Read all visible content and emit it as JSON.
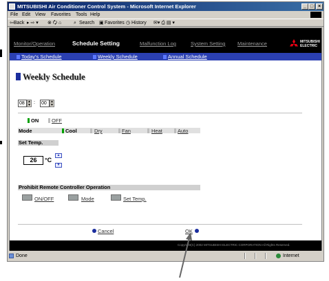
{
  "window": {
    "title": "MITSUBISHI Air Conditioner Control System - Microsoft Internet Explorer",
    "min_symbol": "_",
    "max_symbol": "□",
    "close_symbol": "×"
  },
  "menubar": [
    "File",
    "Edit",
    "View",
    "Favorites",
    "Tools",
    "Help"
  ],
  "toolbar": {
    "back": "⇦Back",
    "forward": "▸ ⇨ ▾",
    "stop_refresh_home": "⊗ 🗘 ⌂",
    "search": "Search",
    "favorites": "Favorites",
    "history": "History",
    "mail_print": "✉▾ ⎙ ▤ ▾"
  },
  "nav": {
    "items": [
      "Monitor/Operation",
      "Schedule Setting",
      "Malfunction Log",
      "System Setting",
      "Maintenance"
    ],
    "active": "Schedule Setting"
  },
  "logo": {
    "line1": "MITSUBISHI",
    "line2": "ELECTRIC"
  },
  "subnav": [
    "Today's Schedule",
    "Weekly Schedule",
    "Annual Schedule"
  ],
  "page": {
    "title": "Weekly Schedule",
    "hour": "08",
    "minute": "00",
    "time_separator": ":",
    "on_label": "ON",
    "off_label": "OFF",
    "mode_label": "Mode",
    "modes": [
      "Cool",
      "Dry",
      "Fan",
      "Heat",
      "Auto"
    ],
    "selected_mode": "Cool",
    "set_temp_label": "Set Temp.",
    "temp_value": "26",
    "temp_unit": "°C",
    "up_arrow": "▲",
    "down_arrow": "▼",
    "prohibit_label": "Prohibit Remote Controller Operation",
    "prohibit_items": [
      "ON/OFF",
      "Mode",
      "Set Temp."
    ],
    "cancel": "Cancel",
    "ok": "OK"
  },
  "footer": {
    "copyright": "Copyright(C) 2002 MITSUBISHI ELECTRIC CORPORATION All Rights Reserved."
  },
  "statusbar": {
    "status": "Done",
    "zone": "Internet"
  },
  "colors": {
    "titlebar": "#0a246a",
    "nav_bg": "#000000",
    "subnav_bg": "#2b40b2",
    "on_indicator": "#00a000",
    "accent": "#e60012"
  }
}
